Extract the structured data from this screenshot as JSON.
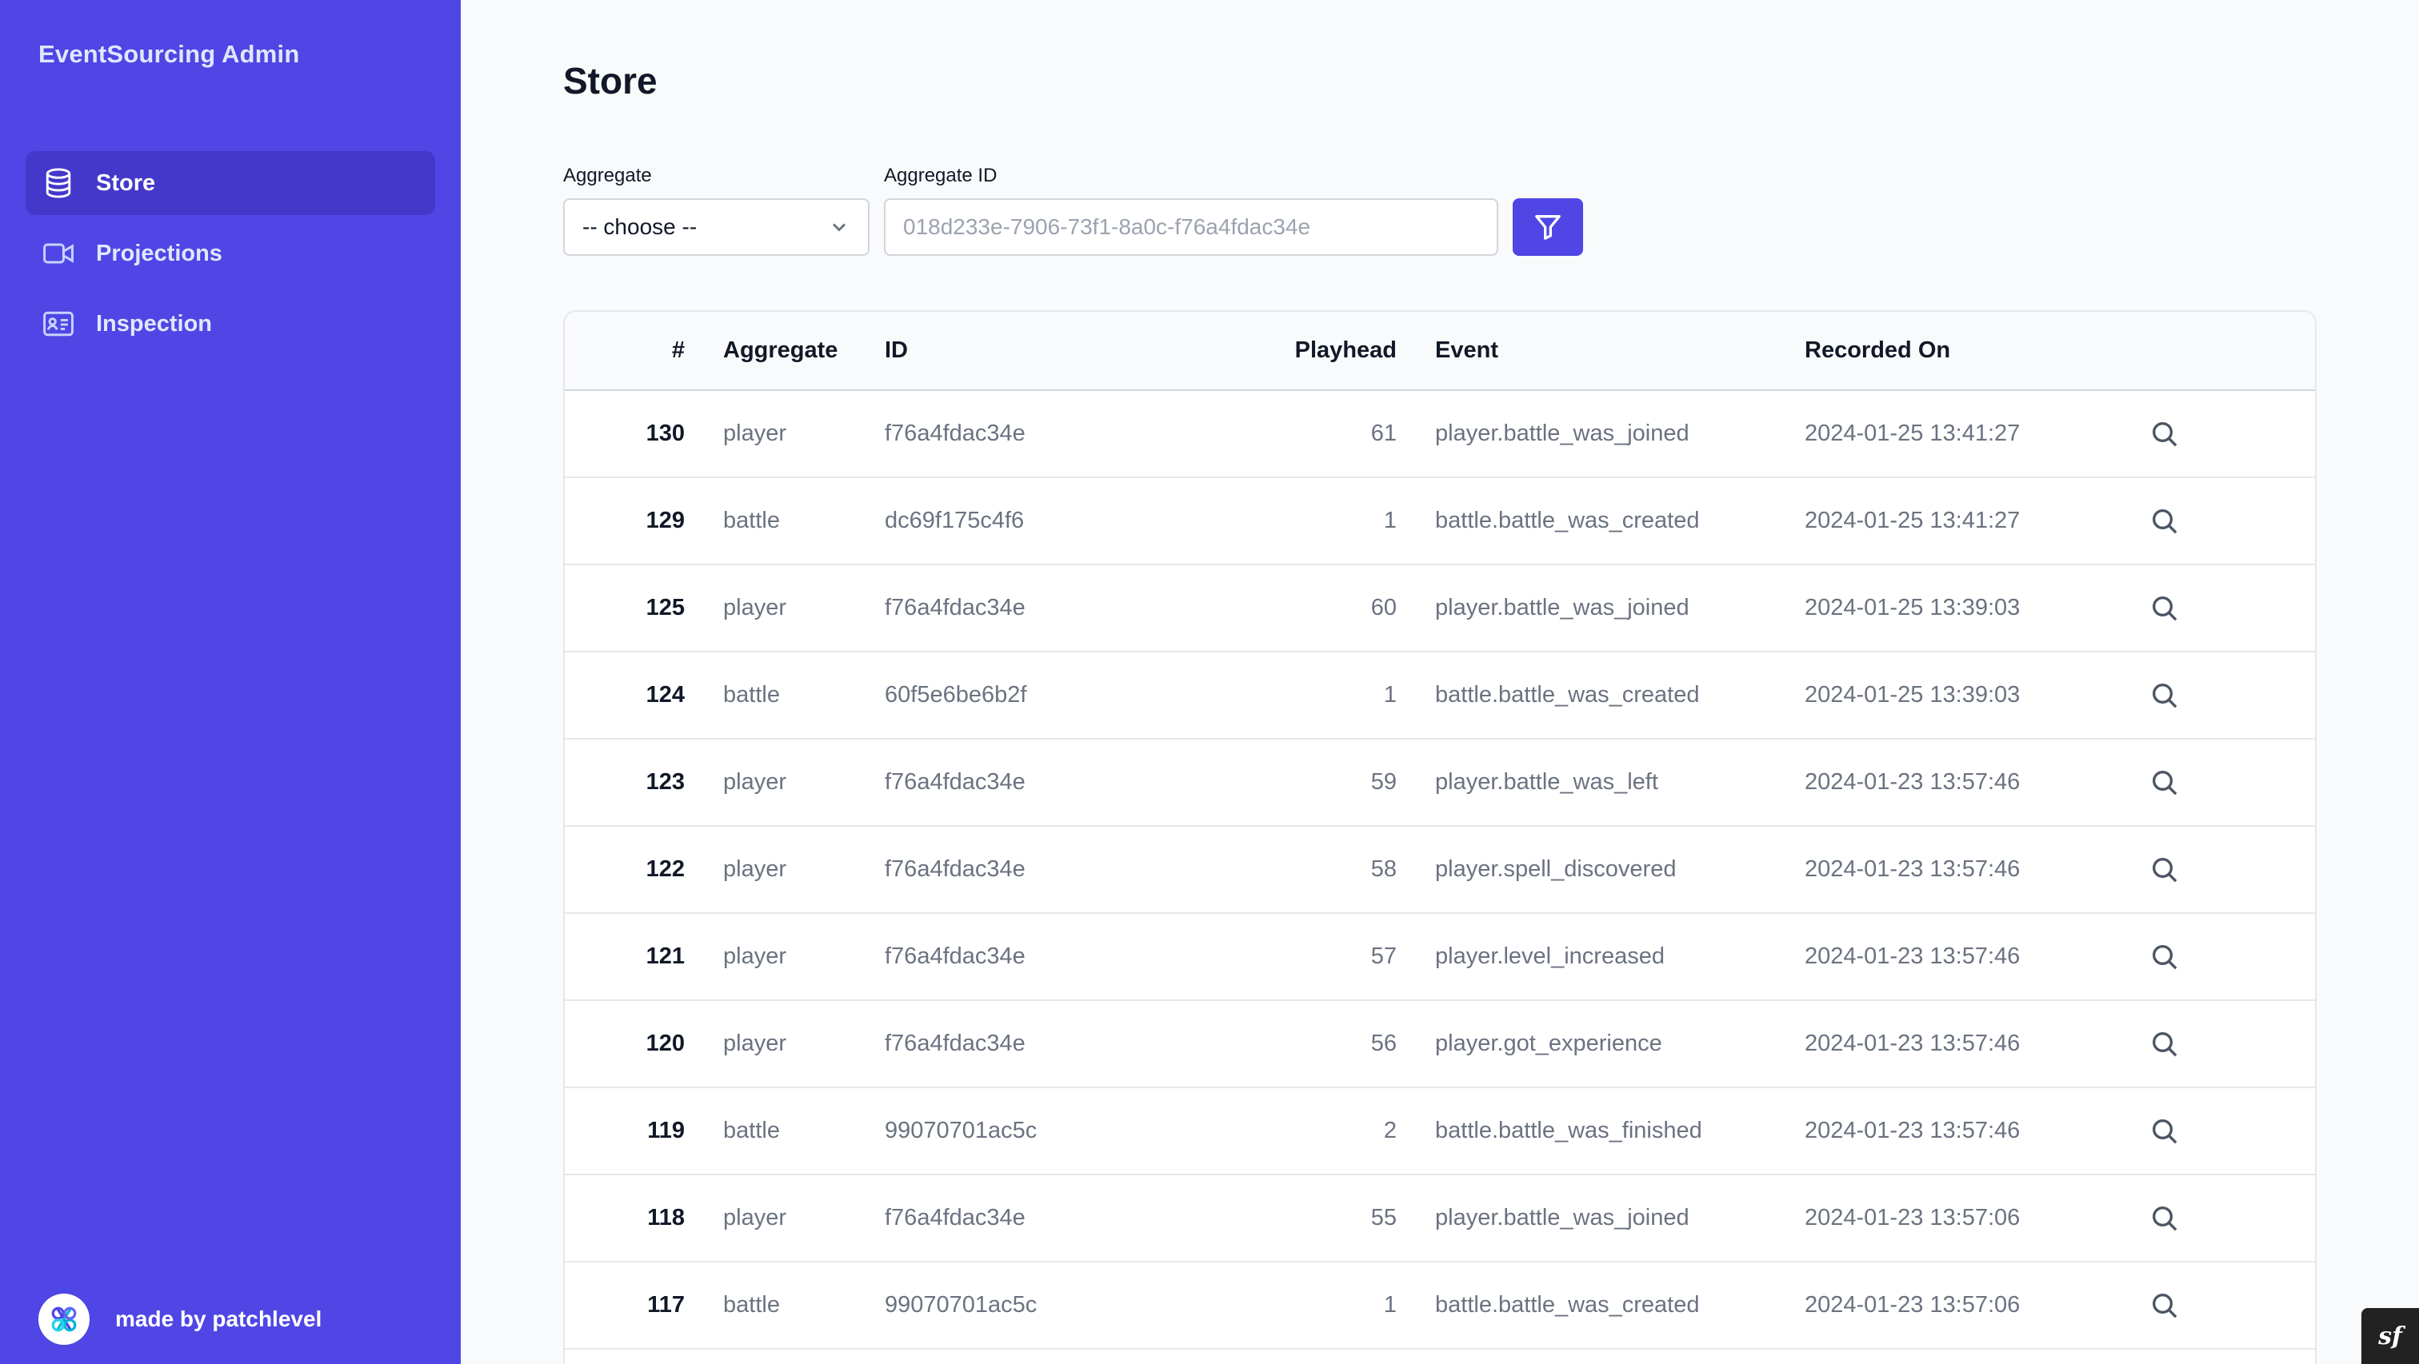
{
  "app": {
    "brand": "EventSourcing Admin"
  },
  "sidebar": {
    "items": [
      {
        "label": "Store",
        "icon": "database-icon",
        "active": true
      },
      {
        "label": "Projections",
        "icon": "video-camera-icon",
        "active": false
      },
      {
        "label": "Inspection",
        "icon": "id-card-icon",
        "active": false
      }
    ],
    "credit": "made by patchlevel"
  },
  "page": {
    "title": "Store"
  },
  "filters": {
    "aggregate_label": "Aggregate",
    "aggregate_value": "-- choose --",
    "aggregate_id_label": "Aggregate ID",
    "aggregate_id_placeholder": "018d233e-7906-73f1-8a0c-f76a4fdac34e"
  },
  "table": {
    "headers": {
      "num": "#",
      "aggregate": "Aggregate",
      "id": "ID",
      "playhead": "Playhead",
      "event": "Event",
      "recorded_on": "Recorded On"
    },
    "rows": [
      {
        "num": "130",
        "aggregate": "player",
        "id": "f76a4fdac34e",
        "playhead": "61",
        "event": "player.battle_was_joined",
        "recorded_on": "2024-01-25 13:41:27"
      },
      {
        "num": "129",
        "aggregate": "battle",
        "id": "dc69f175c4f6",
        "playhead": "1",
        "event": "battle.battle_was_created",
        "recorded_on": "2024-01-25 13:41:27"
      },
      {
        "num": "125",
        "aggregate": "player",
        "id": "f76a4fdac34e",
        "playhead": "60",
        "event": "player.battle_was_joined",
        "recorded_on": "2024-01-25 13:39:03"
      },
      {
        "num": "124",
        "aggregate": "battle",
        "id": "60f5e6be6b2f",
        "playhead": "1",
        "event": "battle.battle_was_created",
        "recorded_on": "2024-01-25 13:39:03"
      },
      {
        "num": "123",
        "aggregate": "player",
        "id": "f76a4fdac34e",
        "playhead": "59",
        "event": "player.battle_was_left",
        "recorded_on": "2024-01-23 13:57:46"
      },
      {
        "num": "122",
        "aggregate": "player",
        "id": "f76a4fdac34e",
        "playhead": "58",
        "event": "player.spell_discovered",
        "recorded_on": "2024-01-23 13:57:46"
      },
      {
        "num": "121",
        "aggregate": "player",
        "id": "f76a4fdac34e",
        "playhead": "57",
        "event": "player.level_increased",
        "recorded_on": "2024-01-23 13:57:46"
      },
      {
        "num": "120",
        "aggregate": "player",
        "id": "f76a4fdac34e",
        "playhead": "56",
        "event": "player.got_experience",
        "recorded_on": "2024-01-23 13:57:46"
      },
      {
        "num": "119",
        "aggregate": "battle",
        "id": "99070701ac5c",
        "playhead": "2",
        "event": "battle.battle_was_finished",
        "recorded_on": "2024-01-23 13:57:46"
      },
      {
        "num": "118",
        "aggregate": "player",
        "id": "f76a4fdac34e",
        "playhead": "55",
        "event": "player.battle_was_joined",
        "recorded_on": "2024-01-23 13:57:06"
      },
      {
        "num": "117",
        "aggregate": "battle",
        "id": "99070701ac5c",
        "playhead": "1",
        "event": "battle.battle_was_created",
        "recorded_on": "2024-01-23 13:57:06"
      }
    ]
  },
  "colors": {
    "sidebar": "#4f46e5",
    "sidebar_active": "#4338ca",
    "accent": "#4f46e5"
  },
  "toolbar_badge": "sf"
}
